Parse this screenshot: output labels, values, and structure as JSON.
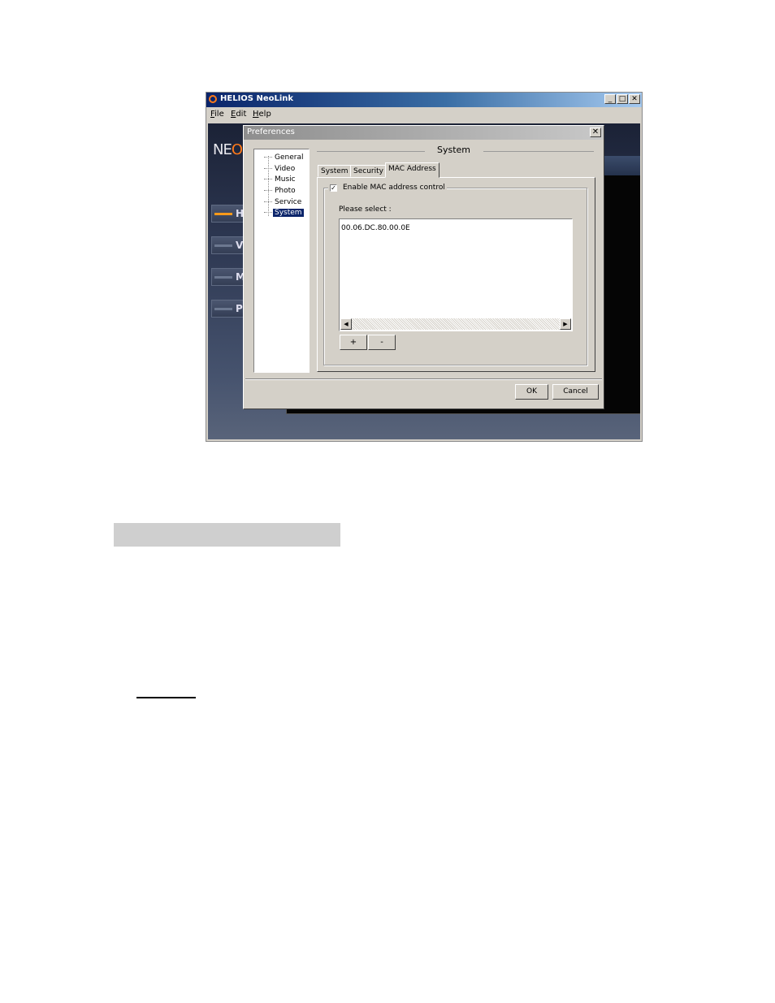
{
  "app": {
    "title": "HELIOS NeoLink",
    "menu": [
      "File",
      "Edit",
      "Help"
    ],
    "caption_buttons": {
      "minimize": "_",
      "maximize": "□",
      "close": "✕"
    },
    "brand_text": "NE",
    "brand_accent": "O",
    "nav_letters": [
      "H",
      "V",
      "M",
      "P"
    ]
  },
  "dialog": {
    "title": "Preferences",
    "close": "✕",
    "tree": [
      "General",
      "Video",
      "Music",
      "Photo",
      "Service",
      "System"
    ],
    "selected": "System",
    "section_title": "System",
    "tabs": [
      "System",
      "Security",
      "MAC Address"
    ],
    "active_tab": "MAC Address",
    "checkbox_label": "Enable MAC address control",
    "checkbox_checked": true,
    "checkmark": "✓",
    "prompt": "Please select :",
    "mac_list": [
      "00.06.DC.80.00.0E"
    ],
    "add_label": "+",
    "remove_label": "-",
    "scroll_left": "◀",
    "scroll_right": "▶",
    "ok_label": "OK",
    "cancel_label": "Cancel"
  },
  "colors": {
    "accent": "#ff7a1a",
    "title_active": "#0a246a",
    "selection": "#0a246a"
  }
}
